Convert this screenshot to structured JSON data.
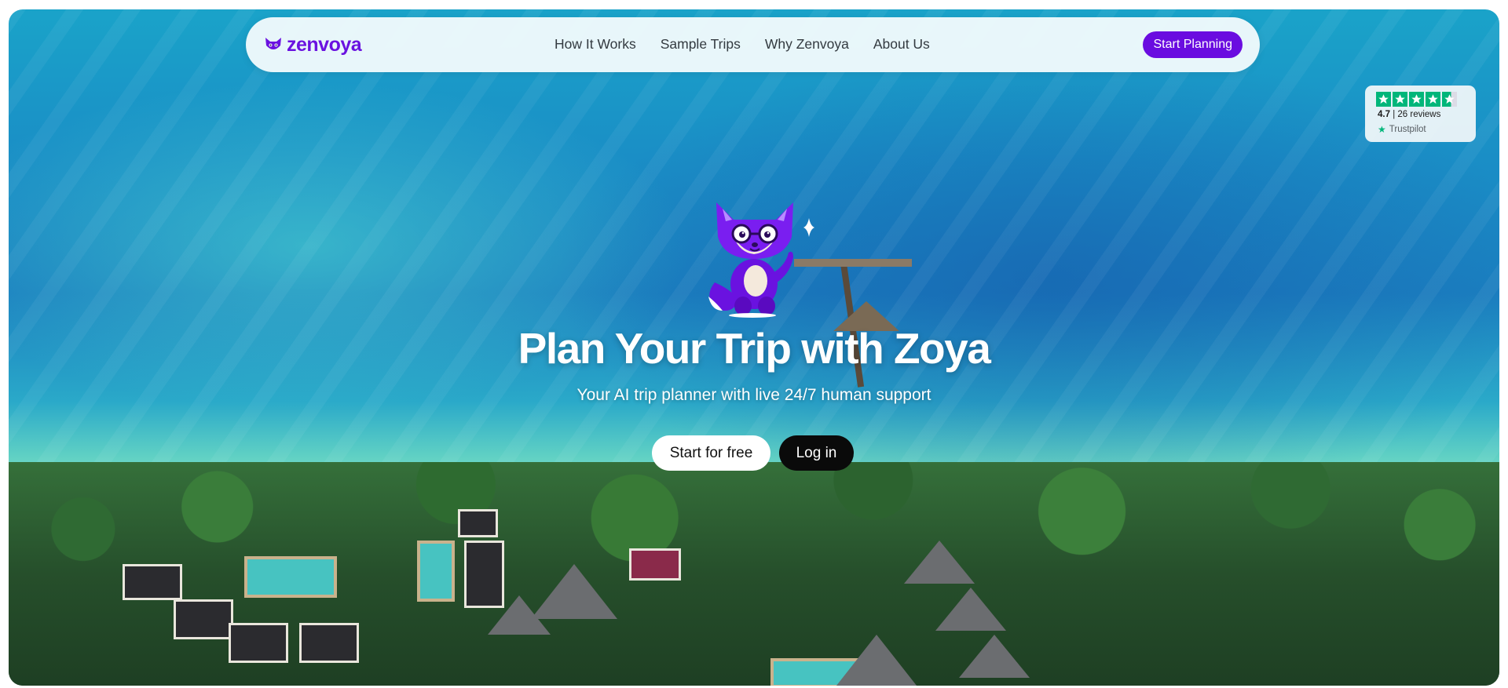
{
  "brand": {
    "name": "zenvoya",
    "color": "#6a12e0"
  },
  "nav": {
    "links": [
      {
        "label": "How It Works"
      },
      {
        "label": "Sample Trips"
      },
      {
        "label": "Why Zenvoya"
      },
      {
        "label": "About Us"
      }
    ],
    "cta_label": "Start Planning"
  },
  "trustpilot": {
    "rating": "4.7",
    "reviews": "26 reviews",
    "stars_filled": 4.6,
    "brand_label": "Trustpilot",
    "star_color": "#00b67a"
  },
  "hero": {
    "title": "Plan Your Trip with Zoya",
    "subtitle": "Your AI trip planner with live 24/7 human support",
    "primary_cta": "Start for free",
    "secondary_cta": "Log in",
    "mascot": "fox-mascot-icon"
  }
}
